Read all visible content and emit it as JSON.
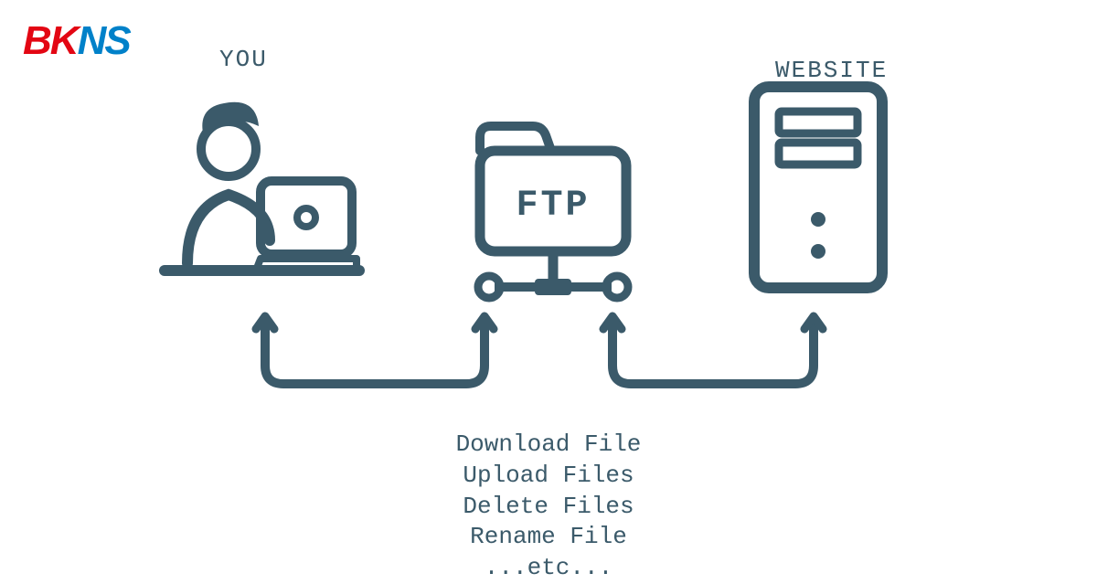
{
  "logo": {
    "part1": "BK",
    "part2": "NS"
  },
  "labels": {
    "you": "YOU",
    "website": "WEBSITE",
    "ftp": "FTP"
  },
  "operations": {
    "line1": "Download File",
    "line2": "Upload Files",
    "line3": "Delete Files",
    "line4": "Rename File",
    "line5": "...etc..."
  }
}
